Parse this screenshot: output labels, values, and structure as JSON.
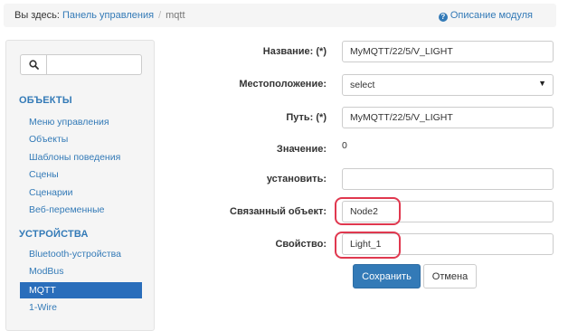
{
  "breadcrumb": {
    "prefix": "Вы здесь:",
    "home": "Панель управления",
    "separator": "/",
    "current": "mqtt"
  },
  "help": {
    "icon": "question-circle-icon",
    "label": "Описание модуля"
  },
  "sidebar": {
    "search": {
      "icon": "search-icon",
      "value": ""
    },
    "sections": [
      {
        "title": "ОБЪЕКТЫ",
        "items": [
          {
            "label": "Меню управления"
          },
          {
            "label": "Объекты"
          },
          {
            "label": "Шаблоны поведения"
          },
          {
            "label": "Сцены"
          },
          {
            "label": "Сценарии"
          },
          {
            "label": "Веб-переменные"
          }
        ]
      },
      {
        "title": "УСТРОЙСТВА",
        "items": [
          {
            "label": "Bluetooth-устройства"
          },
          {
            "label": "ModBus"
          },
          {
            "label": "MQTT",
            "active": true
          },
          {
            "label": "1-Wire"
          }
        ]
      }
    ]
  },
  "form": {
    "name": {
      "label": "Название: (*)",
      "value": "MyMQTT/22/5/V_LIGHT"
    },
    "location": {
      "label": "Местоположение:",
      "value": "select"
    },
    "path": {
      "label": "Путь: (*)",
      "value": "MyMQTT/22/5/V_LIGHT"
    },
    "value": {
      "label": "Значение:",
      "value": "0"
    },
    "set": {
      "label": "установить:",
      "value": ""
    },
    "linked_object": {
      "label": "Связанный объект:",
      "value": "Node2"
    },
    "property": {
      "label": "Свойство:",
      "value": "Light_1"
    }
  },
  "buttons": {
    "save": "Сохранить",
    "cancel": "Отмена"
  },
  "colors": {
    "accent": "#337ab7",
    "active_nav": "#2a6ebb",
    "highlight": "#e0384f"
  }
}
